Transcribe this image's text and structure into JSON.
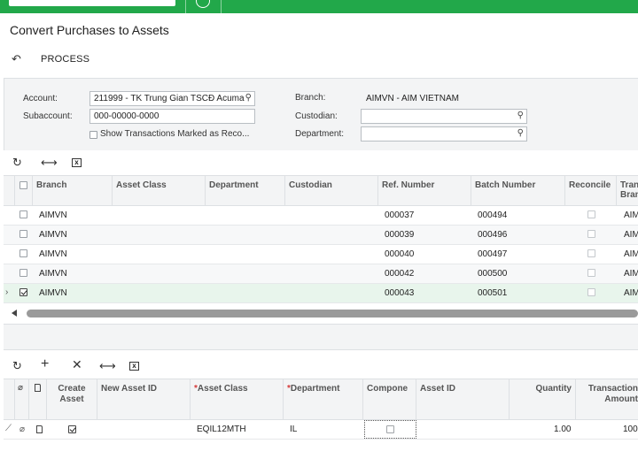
{
  "page": {
    "title": "Convert Purchases to Assets",
    "process_label": "PROCESS"
  },
  "filters": {
    "account_label": "Account:",
    "account_value": "211999 - TK Trung Gian TSCĐ Acuma",
    "subaccount_label": "Subaccount:",
    "subaccount_value": "000-00000-0000",
    "show_reconciled_label": "Show Transactions Marked as Reco...",
    "branch_label": "Branch:",
    "branch_value": "AIMVN - AIM VIETNAM",
    "custodian_label": "Custodian:",
    "custodian_value": "",
    "department_label": "Department:",
    "department_value": ""
  },
  "grid1": {
    "columns": [
      "Branch",
      "Asset Class",
      "Department",
      "Custodian",
      "Ref. Number",
      "Batch Number",
      "Reconcile",
      "Tran",
      "Bran"
    ],
    "rows": [
      {
        "branch": "AIMVN",
        "ref": "000037",
        "batch": "000494",
        "tail": "AIM",
        "checked": false
      },
      {
        "branch": "AIMVN",
        "ref": "000039",
        "batch": "000496",
        "tail": "AIM",
        "checked": false
      },
      {
        "branch": "AIMVN",
        "ref": "000040",
        "batch": "000497",
        "tail": "AIM",
        "checked": false
      },
      {
        "branch": "AIMVN",
        "ref": "000042",
        "batch": "000500",
        "tail": "AIM",
        "checked": false
      },
      {
        "branch": "AIMVN",
        "ref": "000043",
        "batch": "000501",
        "tail": "AIM",
        "checked": true
      }
    ]
  },
  "grid2": {
    "columns": {
      "create_asset_1": "Create",
      "create_asset_2": "Asset",
      "new_asset_id": "New Asset ID",
      "asset_class": "Asset Class",
      "department": "Department",
      "component": "Compone",
      "asset_id": "Asset ID",
      "quantity": "Quantity",
      "transaction_1": "Transaction",
      "transaction_2": "Amount"
    },
    "row": {
      "asset_class": "EQIL12MTH",
      "department": "IL",
      "quantity": "1.00",
      "amount": "100"
    }
  },
  "colors": {
    "topbar": "#22a84a",
    "panel": "#f3f4f5",
    "selected_row": "#e8f5ec"
  },
  "icons": [
    "search-icon",
    "undo-icon",
    "refresh-icon",
    "fit-columns-icon",
    "excel-export-icon",
    "add-icon",
    "delete-icon",
    "attachment-icon",
    "note-icon"
  ]
}
